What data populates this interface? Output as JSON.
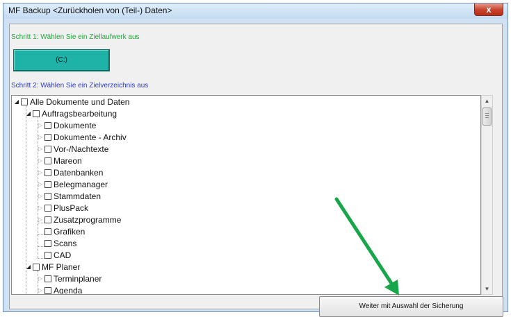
{
  "window": {
    "title": "MF Backup <Zurückholen von (Teil-) Daten>",
    "close_glyph": "x"
  },
  "step1": {
    "label": "Schritt 1: Wählen Sie ein Ziellaufwerk aus",
    "drive_button": "(C:)"
  },
  "step2": {
    "label": "Schritt 2: Wählen Sie ein Zielverzeichnis aus"
  },
  "tree": {
    "root": "Alle Dokumente und Daten",
    "auftragsbearbeitung": {
      "label": "Auftragsbearbeitung",
      "children": [
        "Dokumente",
        "Dokumente - Archiv",
        "Vor-/Nachtexte",
        "Mareon",
        "Datenbanken",
        "Belegmanager",
        "Stammdaten",
        "PlusPack",
        "Zusatzprogramme",
        "Grafiken",
        "Scans",
        "CAD"
      ]
    },
    "mf_planer": {
      "label": "MF Planer",
      "children": [
        "Terminplaner",
        "Agenda"
      ]
    }
  },
  "next_button": "Weiter mit Auswahl der Sicherung",
  "colors": {
    "step1_text": "#21a43a",
    "step2_text": "#2b3bb8",
    "drive_button": "#1fb2a6",
    "annotation_arrow": "#18a64a"
  },
  "icons": {
    "expanded": "triangle-down-right",
    "collapsed": "triangle-right",
    "scroll_up": "triangle-up",
    "scroll_down": "triangle-down"
  }
}
